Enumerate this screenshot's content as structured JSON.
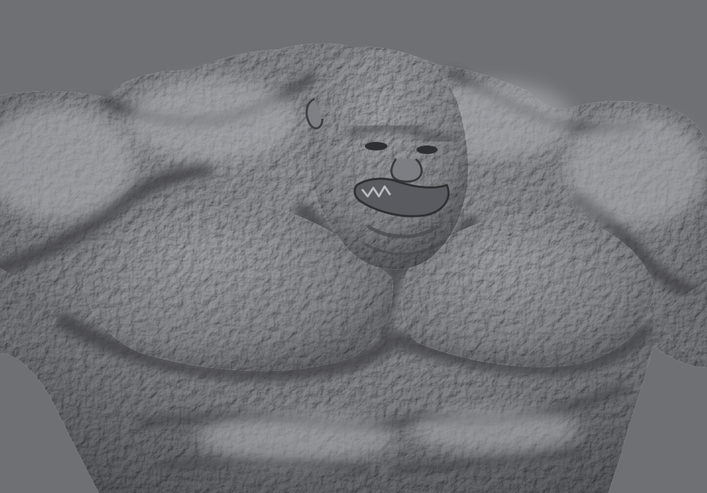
{
  "viewport": {
    "background_color": "#6f7073",
    "subject": "sculpted-creature-bust",
    "material_color": "#8a8b90",
    "shadow_color": "#3e3f43",
    "highlight_color": "#b3b4b8"
  }
}
